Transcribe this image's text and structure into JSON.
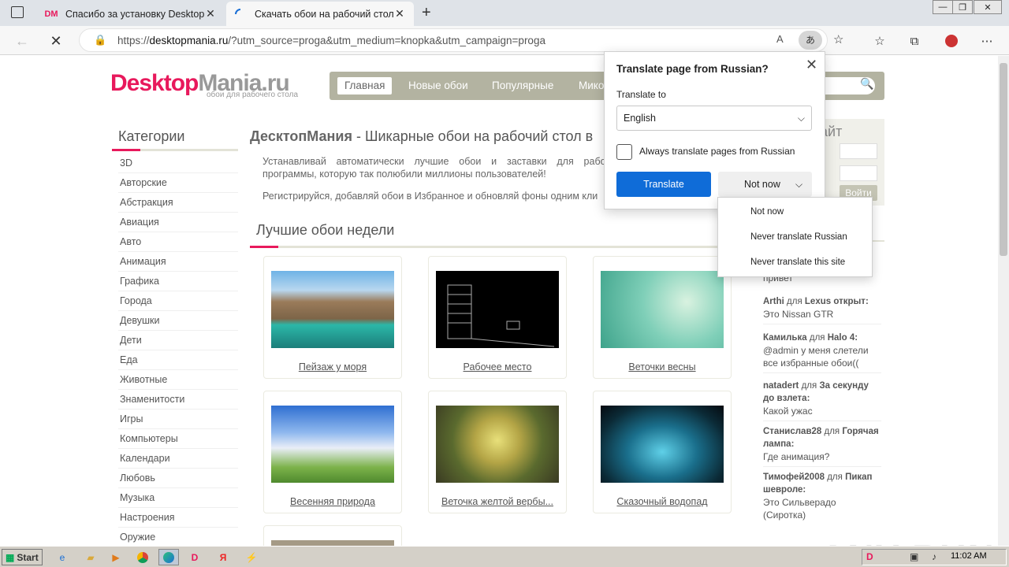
{
  "browser": {
    "tabs": [
      {
        "title": "Спасибо за установку DesktopM",
        "favicon": "DM"
      },
      {
        "title": "Скачать обои на рабочий стол",
        "favicon": "loading"
      }
    ],
    "url_prefix": "https://",
    "url_domain": "desktopmania.ru",
    "url_rest": "/?utm_source=proga&utm_medium=knopka&utm_campaign=proga"
  },
  "site": {
    "logo_a": "Desktop",
    "logo_b": "Mania.ru",
    "slogan": "обои для рабочего стола",
    "menu": [
      "Главная",
      "Новые обои",
      "Популярные",
      "Мико"
    ],
    "categories_title": "Категории",
    "categories": [
      "3D",
      "Авторские",
      "Абстракция",
      "Авиация",
      "Авто",
      "Анимация",
      "Графика",
      "Города",
      "Девушки",
      "Дети",
      "Еда",
      "Животные",
      "Знаменитости",
      "Игры",
      "Компьютеры",
      "Календари",
      "Любовь",
      "Музыка",
      "Настроения",
      "Оружие"
    ],
    "headline_bold": "ДесктопМания",
    "headline_rest": " - Шикарные обои на рабочий стол в",
    "intro_1": "Устанавливай автоматически лучшие обои и заставки для рабочего программы, которую так полюбили миллионы пользователей!",
    "intro_2": "Регистрируйся, добавляй обои в Избранное и обновляй фоны одним кли",
    "best_title": "Лучшие обои недели",
    "wallpapers": [
      "Пейзаж у моря",
      "Рабочее место",
      "Веточки весны",
      "Весенняя природа",
      "Веточка желтой вербы...",
      "Сказочный водопад"
    ],
    "side_title": "айт",
    "login_button": "Войти",
    "comments": [
      {
        "user": "",
        "target": "",
        "text": "привет"
      },
      {
        "user": "Arthi",
        "target": "Lexus открыт",
        "text": "Это Nissan GTR"
      },
      {
        "user": "Камилька",
        "target": "Halo 4",
        "text": "@admin у меня слетели все избранные обои(("
      },
      {
        "user": "natadert",
        "target": "За секунду до взлета",
        "text": "Какой ужас"
      },
      {
        "user": "Станислав28",
        "target": "Горячая лампа",
        "text": "Где анимация?"
      },
      {
        "user": "Тимофей2008",
        "target": "Пикап шевроле",
        "text": "Это Сильверадо (Сиротка)"
      }
    ],
    "for_word": "для"
  },
  "translate": {
    "title": "Translate page from Russian?",
    "label": "Translate to",
    "language": "English",
    "always": "Always translate pages from Russian",
    "translate_btn": "Translate",
    "not_now_btn": "Not now",
    "dropdown": [
      "Not now",
      "Never translate Russian",
      "Never translate this site"
    ]
  },
  "taskbar": {
    "start": "Start",
    "clock": "11:02 AM"
  },
  "watermark": "ANY RUN"
}
